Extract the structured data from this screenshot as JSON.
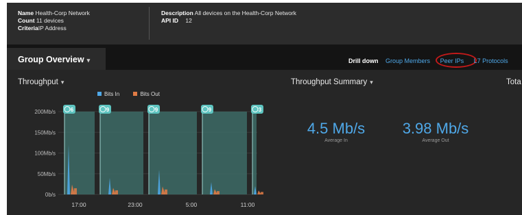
{
  "info": {
    "name_label": "Name",
    "name_value": "Health-Corp Network",
    "count_label": "Count",
    "count_value": "11 devices",
    "criteria_label": "Criteria",
    "criteria_value": "IP Address",
    "description_label": "Description",
    "description_value": "All devices on the Health-Corp Network",
    "apiid_label": "API ID",
    "apiid_value": "12"
  },
  "header": {
    "tab_label": "Group Overview",
    "drill_label": "Drill down",
    "drill_links": [
      "Group Members",
      "Peer IPs",
      "L7 Protocols"
    ],
    "highlighted_link": "Peer IPs",
    "highlight_color": "#c41a1a"
  },
  "throughput": {
    "title": "Throughput",
    "legend": [
      {
        "name": "Bits In",
        "color": "#4fa8e8"
      },
      {
        "name": "Bits Out",
        "color": "#e07b45"
      }
    ]
  },
  "chart_data": {
    "type": "area",
    "title": "Throughput",
    "y_ticks": [
      "200Mb/s",
      "150Mb/s",
      "100Mb/s",
      "50Mb/s",
      "0b/s"
    ],
    "ylim": [
      0,
      200
    ],
    "x_ticks": [
      "17:00",
      "23:00",
      "5:00",
      "11:00"
    ],
    "series": [
      {
        "name": "Bits In",
        "color": "#4fa8e8",
        "peaks": [
          120,
          40,
          60,
          30,
          20
        ]
      },
      {
        "name": "Bits Out",
        "color": "#e07b45",
        "peaks": [
          15,
          10,
          12,
          8,
          6
        ]
      }
    ],
    "alert_markers": [
      {
        "count": "6"
      },
      {
        "count": "9"
      },
      {
        "count": "9"
      },
      {
        "count": "9"
      },
      {
        "count": "3"
      }
    ]
  },
  "summary": {
    "title": "Throughput Summary",
    "average_in_value": "4.5 Mb/s",
    "average_in_label": "Average In",
    "average_out_value": "3.98 Mb/s",
    "average_out_label": "Average Out"
  },
  "total": {
    "title": "Tota"
  },
  "colors": {
    "accent": "#4fa8e8",
    "bits_out": "#e07b45",
    "area_fill": "#3d6b66",
    "marker": "#5ec4c0"
  }
}
